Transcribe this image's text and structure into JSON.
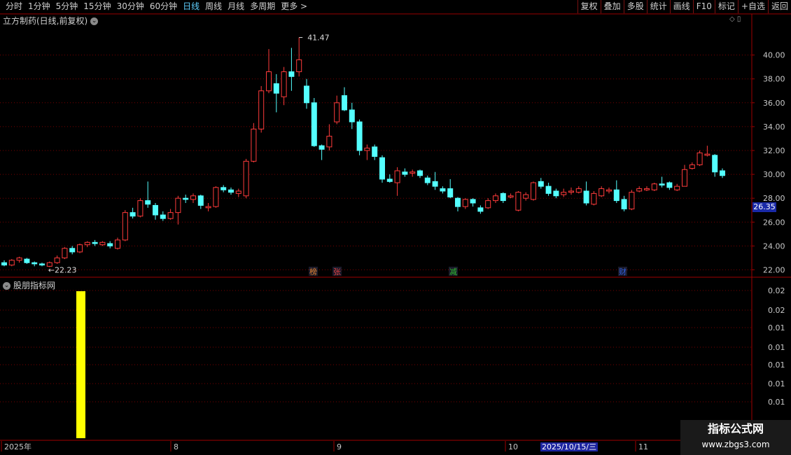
{
  "toolbar": {
    "periods": [
      "分时",
      "1分钟",
      "5分钟",
      "15分钟",
      "30分钟",
      "60分钟",
      "日线",
      "周线",
      "月线",
      "多周期",
      "更多 >"
    ],
    "active_period": "日线",
    "actions": [
      "复权",
      "叠加",
      "多股",
      "统计",
      "画线",
      "F10",
      "标记",
      "+自选",
      "返回"
    ]
  },
  "stock_title": "立方制药(日线,前复权)",
  "indicator_title": "股朋指标网",
  "price_axis": {
    "ticks": [
      "40.00",
      "38.00",
      "36.00",
      "34.00",
      "32.00",
      "30.00",
      "28.00",
      "26.00",
      "24.00",
      "22.00"
    ],
    "min": 21.5,
    "max": 42.5,
    "current_price": "26.35"
  },
  "indicator_axis": {
    "ticks": [
      "0.02",
      "0.02",
      "0.01",
      "0.01",
      "0.01",
      "0.01",
      "0.01"
    ]
  },
  "annotations": {
    "high": "41.47",
    "low": "22.23"
  },
  "event_markers": [
    {
      "label": "榜",
      "color": "#e08030"
    },
    {
      "label": "张",
      "color": "#e04040"
    },
    {
      "label": "减",
      "color": "#30c030"
    },
    {
      "label": "财",
      "color": "#3060e0"
    }
  ],
  "date_axis": {
    "labels": [
      "2025年",
      "8",
      "9",
      "10",
      "11"
    ],
    "highlight": "2025/10/15/三"
  },
  "watermark": {
    "line1": "指标公式网",
    "line2": "www.zbgs3.com"
  },
  "colors": {
    "up": "#ff3b3b",
    "down": "#54ffff",
    "grid": "#7a0000",
    "indicator_bar": "#ffff00",
    "axis_text": "#c8c8c8"
  },
  "candles": [
    [
      22.6,
      22.4,
      22.8,
      22.3
    ],
    [
      22.4,
      22.8,
      22.9,
      22.3
    ],
    [
      22.8,
      23.0,
      23.1,
      22.6
    ],
    [
      22.9,
      22.6,
      23.0,
      22.5
    ],
    [
      22.6,
      22.5,
      22.7,
      22.3
    ],
    [
      22.5,
      22.4,
      22.6,
      22.3
    ],
    [
      22.3,
      22.6,
      22.7,
      22.23
    ],
    [
      22.6,
      23.0,
      23.2,
      22.5
    ],
    [
      23.0,
      23.8,
      23.9,
      22.9
    ],
    [
      23.8,
      23.5,
      24.0,
      23.3
    ],
    [
      23.5,
      24.1,
      24.2,
      23.4
    ],
    [
      24.1,
      24.3,
      24.4,
      23.9
    ],
    [
      24.3,
      24.2,
      24.5,
      24.0
    ],
    [
      24.1,
      24.3,
      24.4,
      24.0
    ],
    [
      24.2,
      24.0,
      24.4,
      23.8
    ],
    [
      23.8,
      24.5,
      24.7,
      23.7
    ],
    [
      24.5,
      26.8,
      27.0,
      24.4
    ],
    [
      26.8,
      26.5,
      27.2,
      26.3
    ],
    [
      26.5,
      27.8,
      28.0,
      26.4
    ],
    [
      27.8,
      27.5,
      29.4,
      27.2
    ],
    [
      27.4,
      26.6,
      27.6,
      26.2
    ],
    [
      26.6,
      26.3,
      26.9,
      26.1
    ],
    [
      26.3,
      26.8,
      27.1,
      26.2
    ],
    [
      26.8,
      28.0,
      28.2,
      25.8
    ],
    [
      28.0,
      27.9,
      28.3,
      27.6
    ],
    [
      27.9,
      28.2,
      28.4,
      27.6
    ],
    [
      28.2,
      27.4,
      28.3,
      27.1
    ],
    [
      27.2,
      27.3,
      27.6,
      26.9
    ],
    [
      27.3,
      28.9,
      29.0,
      27.2
    ],
    [
      28.9,
      28.7,
      29.1,
      28.5
    ],
    [
      28.7,
      28.5,
      28.9,
      28.3
    ],
    [
      28.4,
      28.6,
      28.8,
      28.1
    ],
    [
      28.2,
      31.1,
      31.3,
      28.0
    ],
    [
      31.1,
      33.8,
      34.3,
      31.0
    ],
    [
      33.8,
      37.0,
      37.4,
      33.5
    ],
    [
      37.0,
      38.6,
      40.5,
      36.8
    ],
    [
      37.6,
      36.8,
      38.4,
      35.2
    ],
    [
      36.5,
      38.6,
      39.0,
      35.8
    ],
    [
      38.6,
      38.2,
      40.6,
      37.0
    ],
    [
      38.6,
      39.6,
      41.47,
      38.2
    ],
    [
      37.4,
      36.0,
      38.0,
      35.5
    ],
    [
      36.0,
      32.4,
      36.4,
      32.3
    ],
    [
      32.4,
      32.1,
      32.5,
      31.2
    ],
    [
      32.3,
      33.2,
      34.2,
      32.0
    ],
    [
      34.4,
      36.0,
      36.6,
      34.2
    ],
    [
      36.6,
      35.4,
      37.3,
      35.3
    ],
    [
      35.4,
      34.4,
      36.0,
      33.8
    ],
    [
      34.4,
      32.0,
      34.6,
      31.6
    ],
    [
      32.0,
      32.2,
      32.5,
      31.2
    ],
    [
      32.3,
      31.5,
      32.5,
      31.2
    ],
    [
      31.4,
      29.6,
      31.6,
      29.3
    ],
    [
      29.6,
      29.4,
      30.0,
      29.3
    ],
    [
      29.3,
      30.3,
      30.6,
      28.2
    ],
    [
      30.2,
      30.0,
      30.5,
      29.8
    ],
    [
      30.1,
      30.2,
      30.4,
      29.8
    ],
    [
      30.3,
      29.9,
      30.4,
      29.7
    ],
    [
      29.7,
      29.3,
      29.9,
      29.1
    ],
    [
      29.4,
      29.0,
      30.2,
      28.7
    ],
    [
      28.8,
      28.6,
      29.0,
      28.4
    ],
    [
      28.8,
      28.1,
      29.6,
      28.0
    ],
    [
      28.0,
      27.3,
      28.1,
      26.9
    ],
    [
      27.3,
      27.9,
      28.0,
      27.1
    ],
    [
      27.9,
      27.6,
      28.0,
      27.3
    ],
    [
      27.2,
      26.9,
      27.4,
      26.7
    ],
    [
      27.2,
      27.8,
      28.0,
      27.1
    ],
    [
      27.8,
      28.2,
      28.4,
      27.6
    ],
    [
      28.4,
      27.8,
      28.5,
      27.6
    ],
    [
      28.1,
      28.2,
      28.4,
      28.0
    ],
    [
      27.0,
      28.5,
      28.6,
      26.9
    ],
    [
      28.0,
      28.3,
      28.5,
      27.8
    ],
    [
      27.9,
      29.3,
      29.4,
      27.8
    ],
    [
      29.4,
      29.0,
      29.7,
      28.8
    ],
    [
      29.0,
      28.4,
      29.3,
      28.2
    ],
    [
      28.6,
      28.2,
      28.8,
      28.0
    ],
    [
      28.3,
      28.5,
      28.8,
      28.1
    ],
    [
      28.5,
      28.6,
      28.9,
      28.3
    ],
    [
      28.5,
      28.8,
      29.0,
      28.4
    ],
    [
      28.6,
      27.6,
      29.4,
      27.4
    ],
    [
      27.5,
      28.4,
      28.6,
      27.4
    ],
    [
      28.2,
      28.8,
      29.0,
      28.1
    ],
    [
      28.6,
      28.7,
      28.9,
      28.4
    ],
    [
      28.7,
      27.8,
      29.5,
      27.6
    ],
    [
      27.9,
      27.1,
      28.2,
      26.9
    ],
    [
      27.1,
      28.5,
      28.7,
      27.0
    ],
    [
      28.6,
      28.8,
      29.0,
      28.5
    ],
    [
      28.7,
      28.8,
      29.0,
      28.6
    ],
    [
      28.7,
      29.2,
      29.3,
      28.6
    ],
    [
      29.2,
      29.1,
      29.8,
      28.9
    ],
    [
      29.3,
      28.9,
      29.4,
      28.7
    ],
    [
      28.7,
      29.0,
      29.2,
      28.6
    ],
    [
      29.0,
      30.4,
      30.8,
      29.0
    ],
    [
      30.5,
      30.8,
      31.0,
      30.4
    ],
    [
      30.8,
      31.8,
      32.0,
      30.7
    ],
    [
      31.6,
      31.7,
      32.4,
      31.5
    ],
    [
      31.6,
      30.2,
      31.7,
      29.8
    ],
    [
      30.3,
      29.9,
      30.5,
      29.7
    ]
  ],
  "indicator_bar_value": "0.02"
}
